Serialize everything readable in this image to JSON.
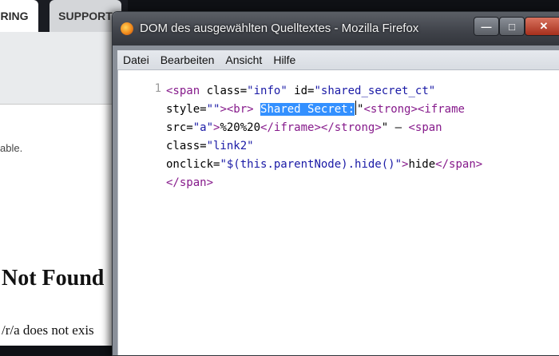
{
  "background_page": {
    "tabs": [
      {
        "label": "RING"
      },
      {
        "label": "SUPPORT"
      }
    ],
    "small_text": "able.",
    "heading": "Not Found",
    "body_text": "/r/a does not exis"
  },
  "window": {
    "title": "DOM des ausgewählten Quelltextes - Mozilla Firefox",
    "controls": {
      "minimize": "—",
      "maximize": "□",
      "close": "✕"
    }
  },
  "menu": [
    {
      "label": "Datei"
    },
    {
      "label": "Bearbeiten"
    },
    {
      "label": "Ansicht"
    },
    {
      "label": "Hilfe"
    }
  ],
  "source": {
    "line_number": "1",
    "selected_text": "Shared Secret:",
    "lines": {
      "l1": {
        "tag": "<span",
        "attr1": " class=",
        "val1": "\"info\"",
        "attr2": " id=",
        "val2": "\"shared_secret_ct\""
      },
      "l2": {
        "attr": "style=",
        "val": "\"\"",
        "tag1": ">",
        "tag2": "<br>",
        "sp": " ",
        "q": "\"",
        "tag3": "<strong>",
        "tag4": "<iframe"
      },
      "l3": {
        "attr": "src=",
        "val": "\"a\"",
        "tag1": ">",
        "ent": "%20%20",
        "tag2": "</iframe>",
        "tag3": "</strong>",
        "txt": "\" — ",
        "tag4": "<span"
      },
      "l4": {
        "attr": "class=",
        "val": "\"link2\""
      },
      "l5": {
        "attr": "onclick=",
        "val": "\"$(this.parentNode).hide()\"",
        "tag1": ">",
        "txt": "hide",
        "tag2": "</span>"
      },
      "l6": {
        "tag": "</span>"
      }
    }
  }
}
